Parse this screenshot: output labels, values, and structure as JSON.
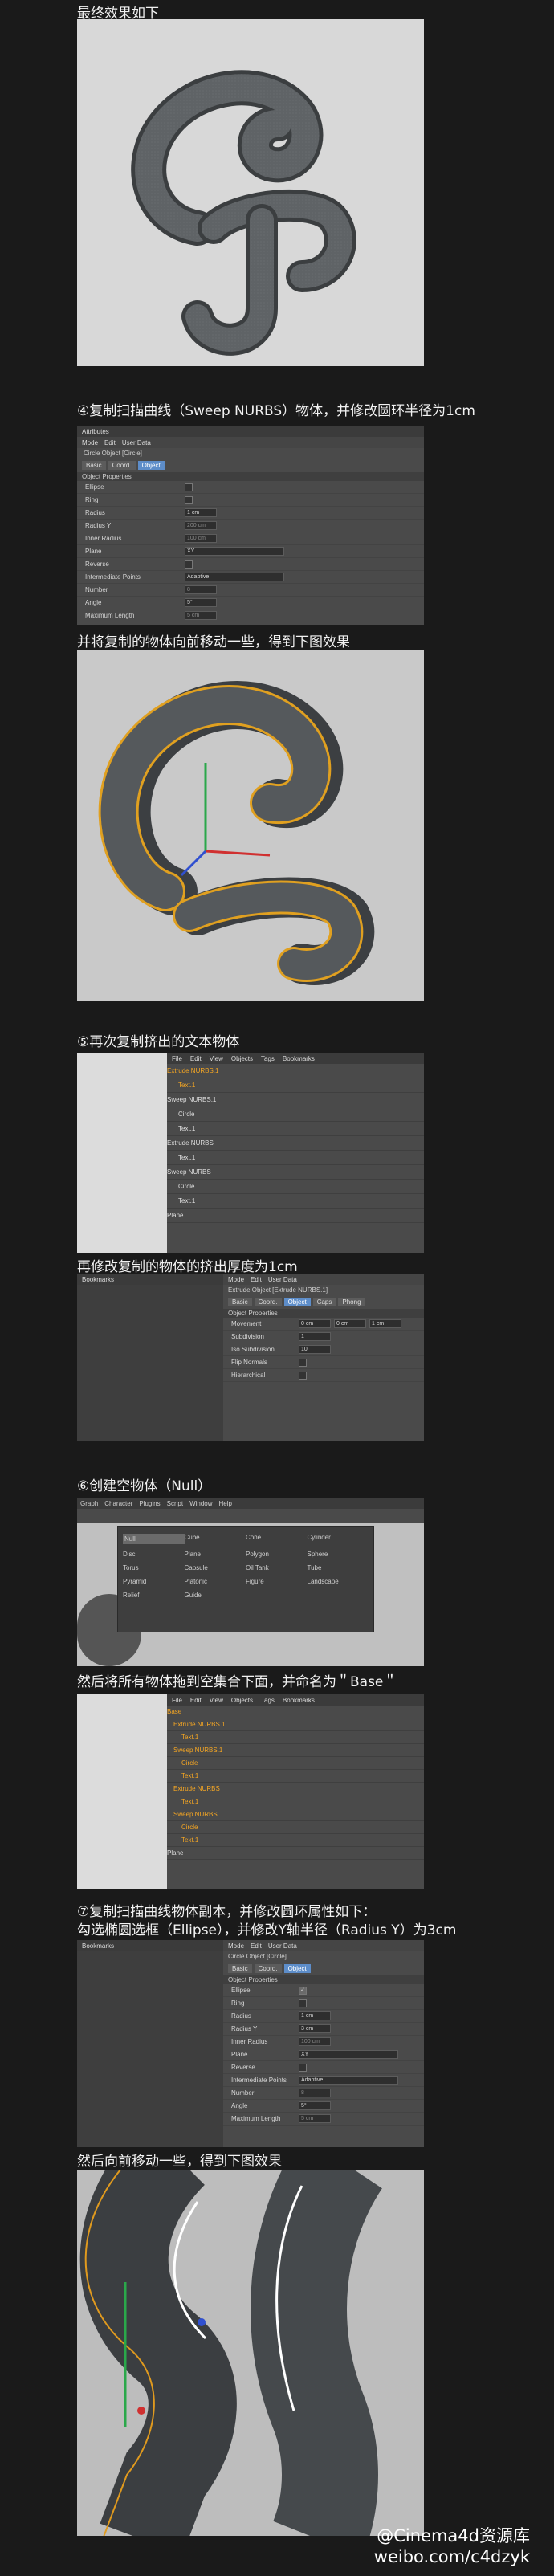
{
  "captions": {
    "c1": "最终效果如下",
    "c2": "④复制扫描曲线（Sweep NURBS）物体，并修改圆环半径为1cm",
    "c3": "并将复制的物体向前移动一些，得到下图效果",
    "c4": "⑤再次复制挤出的文本物体",
    "c5": "再修改复制的物体的挤出厚度为1cm",
    "c6": "⑥创建空物体（Null）",
    "c7": "然后将所有物体拖到空集合下面，并命名为＂Base＂",
    "c8a": "⑦复制扫描曲线物体副本，并修改圆环属性如下：",
    "c8b": "勾选椭圆选框（Ellipse），并修改Y轴半径（Radius Y）为3cm",
    "c9": "然后向前移动一些，得到下图效果"
  },
  "attr1": {
    "title": "Attributes",
    "menu": [
      "Mode",
      "Edit",
      "User Data"
    ],
    "object": "Circle Object [Circle]",
    "tabs": [
      "Basic",
      "Coord.",
      "Object"
    ],
    "section": "Object Properties",
    "rows": [
      {
        "label": "Ellipse",
        "value": ""
      },
      {
        "label": "Ring",
        "value": ""
      },
      {
        "label": "Radius",
        "value": "1 cm"
      },
      {
        "label": "Radius Y",
        "value": "200 cm"
      },
      {
        "label": "Inner Radius",
        "value": "100 cm"
      },
      {
        "label": "Plane",
        "value": "XY"
      },
      {
        "label": "Reverse",
        "value": ""
      },
      {
        "label": "Intermediate Points",
        "value": "Adaptive"
      },
      {
        "label": "Number",
        "value": "8"
      },
      {
        "label": "Angle",
        "value": "5°"
      },
      {
        "label": "Maximum Length",
        "value": "5 cm"
      }
    ]
  },
  "objmgr1": {
    "menu": [
      "File",
      "Edit",
      "View",
      "Objects",
      "Tags",
      "Bookmarks"
    ],
    "items": [
      "Extrude NURBS.1",
      "Text.1",
      "Sweep NURBS.1",
      "Circle",
      "Text.1",
      "Extrude NURBS",
      "Text.1",
      "Sweep NURBS",
      "Circle",
      "Text.1",
      "Plane"
    ]
  },
  "attr2": {
    "menu": [
      "Mode",
      "Edit",
      "User Data"
    ],
    "object": "Extrude Object [Extrude NURBS.1]",
    "tabs": [
      "Basic",
      "Coord.",
      "Object",
      "Caps",
      "Phong"
    ],
    "section": "Object Properties",
    "rows": [
      {
        "label": "Movement",
        "value": "0 cm",
        "v2": "0 cm",
        "v3": "1 cm"
      },
      {
        "label": "Subdivision",
        "value": "1"
      },
      {
        "label": "Iso Subdivision",
        "value": "10"
      },
      {
        "label": "Flip Normals",
        "value": ""
      },
      {
        "label": "Hierarchical",
        "value": ""
      }
    ]
  },
  "menu3": {
    "bar": [
      "Graph",
      "Character",
      "Plugins",
      "Script",
      "Window",
      "Help"
    ],
    "items": [
      [
        "Null",
        "Cube",
        "Cone",
        "Cylinder"
      ],
      [
        "Disc",
        "Plane",
        "Polygon",
        "Sphere"
      ],
      [
        "Torus",
        "Capsule",
        "Oil Tank",
        "Tube"
      ],
      [
        "Pyramid",
        "Platonic",
        "Figure",
        "Landscape"
      ],
      [
        "Relief",
        "Guide",
        "",
        ""
      ]
    ]
  },
  "objmgr2": {
    "menu": [
      "File",
      "Edit",
      "View",
      "Objects",
      "Tags",
      "Bookmarks"
    ],
    "items": [
      "Base",
      "Extrude NURBS.1",
      "Text.1",
      "Sweep NURBS.1",
      "Circle",
      "Text.1",
      "Extrude NURBS",
      "Text.1",
      "Sweep NURBS",
      "Circle",
      "Text.1",
      "Plane"
    ]
  },
  "attr3": {
    "menu": [
      "Mode",
      "Edit",
      "User Data"
    ],
    "object": "Circle Object [Circle]",
    "tabs": [
      "Basic",
      "Coord.",
      "Object"
    ],
    "section": "Object Properties",
    "rows": [
      {
        "label": "Ellipse",
        "value": "✓"
      },
      {
        "label": "Ring",
        "value": ""
      },
      {
        "label": "Radius",
        "value": "1 cm"
      },
      {
        "label": "Radius Y",
        "value": "3 cm"
      },
      {
        "label": "Inner Radius",
        "value": "100 cm"
      },
      {
        "label": "Plane",
        "value": "XY"
      },
      {
        "label": "Reverse",
        "value": ""
      },
      {
        "label": "Intermediate Points",
        "value": "Adaptive"
      },
      {
        "label": "Number",
        "value": "8"
      },
      {
        "label": "Angle",
        "value": "5°"
      },
      {
        "label": "Maximum Length",
        "value": "5 cm"
      }
    ]
  },
  "left_panel": {
    "label": "Bookmarks"
  },
  "watermark": {
    "line1": "@Cinema4d资源库",
    "line2": "weibo.com/c4dzyk"
  }
}
